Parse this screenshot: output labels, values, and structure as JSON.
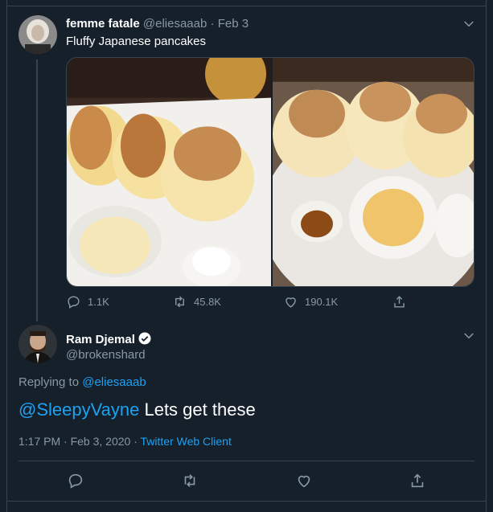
{
  "tweet1": {
    "display_name": "femme fatale",
    "handle": "@eliesaaab",
    "date_sep": "·",
    "date": "Feb 3",
    "text": "Fluffy Japanese pancakes",
    "replies": "1.1K",
    "retweets": "45.8K",
    "likes": "190.1K"
  },
  "tweet2": {
    "display_name": "Ram Djemal",
    "handle": "@brokenshard",
    "replying_prefix": "Replying to",
    "replying_to": "@eliesaaab",
    "mention": "@SleepyVayne",
    "text": " Lets get these",
    "time": "1:17 PM · Feb 3, 2020 ·",
    "client": "Twitter Web Client"
  },
  "colors": {
    "background": "#15202b",
    "border": "#38444d",
    "muted": "#8899a6",
    "accent": "#1da1f2"
  },
  "icons": {
    "reply": "reply-icon",
    "retweet": "retweet-icon",
    "like": "heart-icon",
    "share": "share-icon",
    "more": "chevron-down-icon",
    "verified": "verified-badge-icon"
  }
}
